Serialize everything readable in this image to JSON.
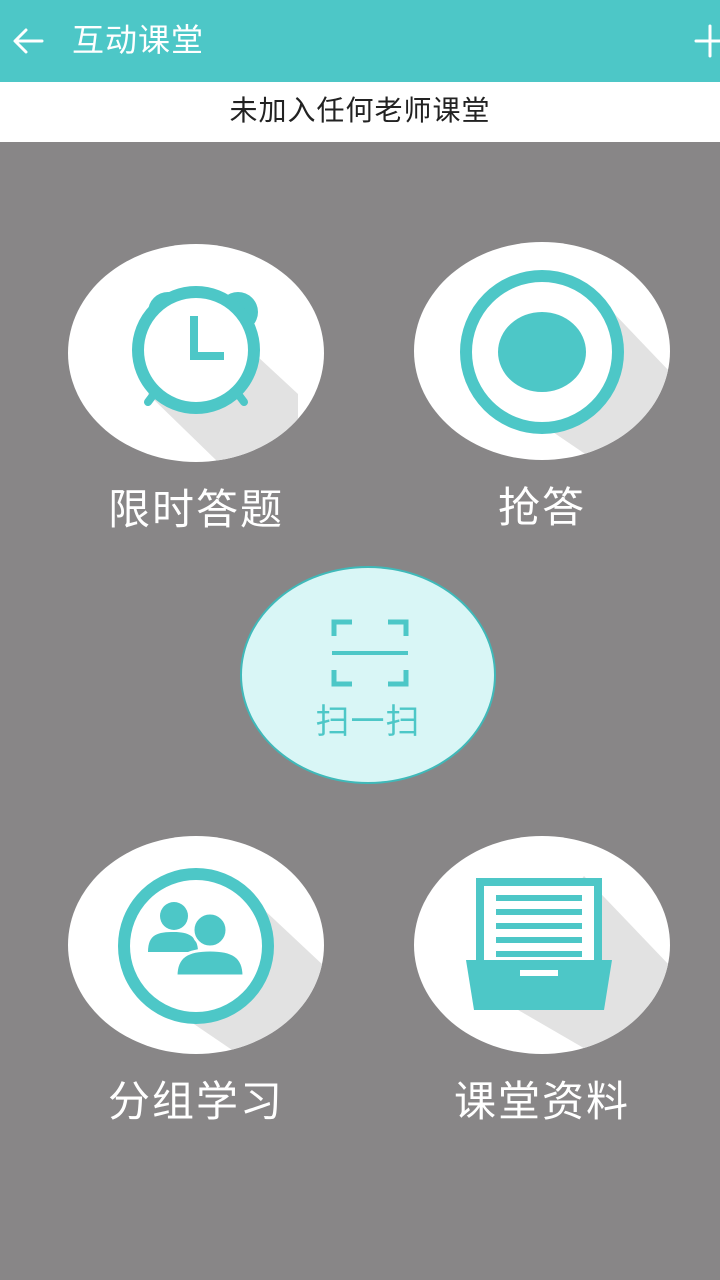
{
  "header": {
    "title": "互动课堂"
  },
  "status": {
    "text": "未加入任何老师课堂"
  },
  "features": {
    "timed_quiz": {
      "label": "限时答题",
      "icon": "alarm-clock-icon"
    },
    "quick_answer": {
      "label": "抢答",
      "icon": "record-circle-icon"
    },
    "scan": {
      "label": "扫一扫",
      "icon": "scan-frame-icon"
    },
    "group_study": {
      "label": "分组学习",
      "icon": "users-icon"
    },
    "class_materials": {
      "label": "课堂资料",
      "icon": "file-tray-icon"
    }
  },
  "colors": {
    "accent": "#4dc7c7",
    "background": "#888687",
    "scan_fill": "#d9f6f6"
  }
}
